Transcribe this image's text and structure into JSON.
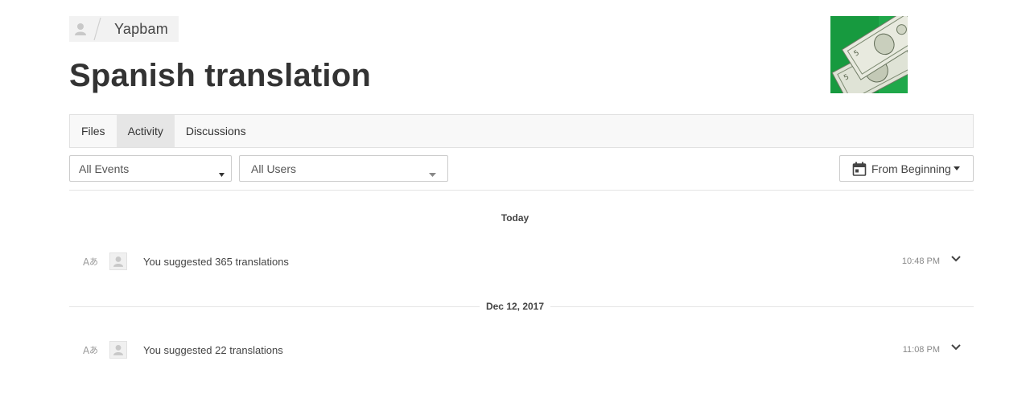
{
  "breadcrumb": {
    "avatar_icon": "user-avatar-icon",
    "project_name": "Yapbam"
  },
  "page": {
    "title": "Spanish translation",
    "project_image": "dollar-bills-image"
  },
  "tabs": [
    {
      "label": "Files",
      "active": false
    },
    {
      "label": "Activity",
      "active": true
    },
    {
      "label": "Discussions",
      "active": false
    }
  ],
  "filters": {
    "events": {
      "selected": "All Events"
    },
    "users": {
      "selected": "All Users"
    },
    "date": {
      "selected": "From Beginning",
      "icon": "calendar-icon"
    }
  },
  "activity": {
    "groups": [
      {
        "date_label": "Today",
        "events": [
          {
            "icon": "translate-icon",
            "text": "You suggested 365 translations",
            "time": "10:48 PM"
          }
        ]
      },
      {
        "date_label": "Dec 12, 2017",
        "events": [
          {
            "icon": "translate-icon",
            "text": "You suggested 22 translations",
            "time": "11:08 PM"
          }
        ]
      }
    ]
  },
  "colors": {
    "tab_active_bg": "#e6e6e6",
    "border": "#e1e1e1",
    "image_green": "#1fa84a"
  }
}
